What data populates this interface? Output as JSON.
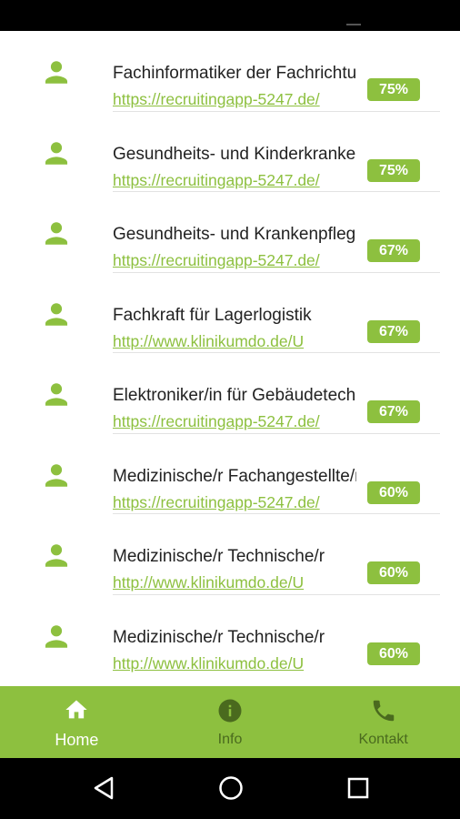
{
  "colors": {
    "accent": "#8dc03f",
    "inactive_nav": "#4a6a1e",
    "text": "#222222"
  },
  "list": {
    "items": [
      {
        "title": "Fachinformatiker der Fachrichtung",
        "url": "https://recruitingapp-5247.de/",
        "match": "75%",
        "icon": "person-icon"
      },
      {
        "title": "Gesundheits- und Kinderkrankenpfleger",
        "url": "https://recruitingapp-5247.de/",
        "match": "75%",
        "icon": "person-icon"
      },
      {
        "title": "Gesundheits- und Krankenpfleger",
        "url": "https://recruitingapp-5247.de/",
        "match": "67%",
        "icon": "person-icon"
      },
      {
        "title": "Fachkraft für Lagerlogistik",
        "url": "http://www.klinikumdo.de/U",
        "match": "67%",
        "icon": "person-icon"
      },
      {
        "title": "Elektroniker/in für Gebäudetechnik",
        "url": "https://recruitingapp-5247.de/",
        "match": "67%",
        "icon": "person-icon"
      },
      {
        "title": "Medizinische/r Fachangestellte/r",
        "url": "https://recruitingapp-5247.de/",
        "match": "60%",
        "icon": "person-icon"
      },
      {
        "title": "Medizinische/r Technische/r",
        "url": "http://www.klinikumdo.de/U",
        "match": "60%",
        "icon": "person-icon"
      },
      {
        "title": "Medizinische/r Technische/r",
        "url": "http://www.klinikumdo.de/U",
        "match": "60%",
        "icon": "person-icon"
      }
    ]
  },
  "bottom_nav": {
    "items": [
      {
        "label": "Home",
        "icon": "home-icon",
        "active": true
      },
      {
        "label": "Info",
        "icon": "info-icon",
        "active": false
      },
      {
        "label": "Kontakt",
        "icon": "phone-icon",
        "active": false
      }
    ]
  },
  "system_nav": {
    "icons": [
      "back-icon",
      "home-circle-icon",
      "recents-icon"
    ]
  }
}
